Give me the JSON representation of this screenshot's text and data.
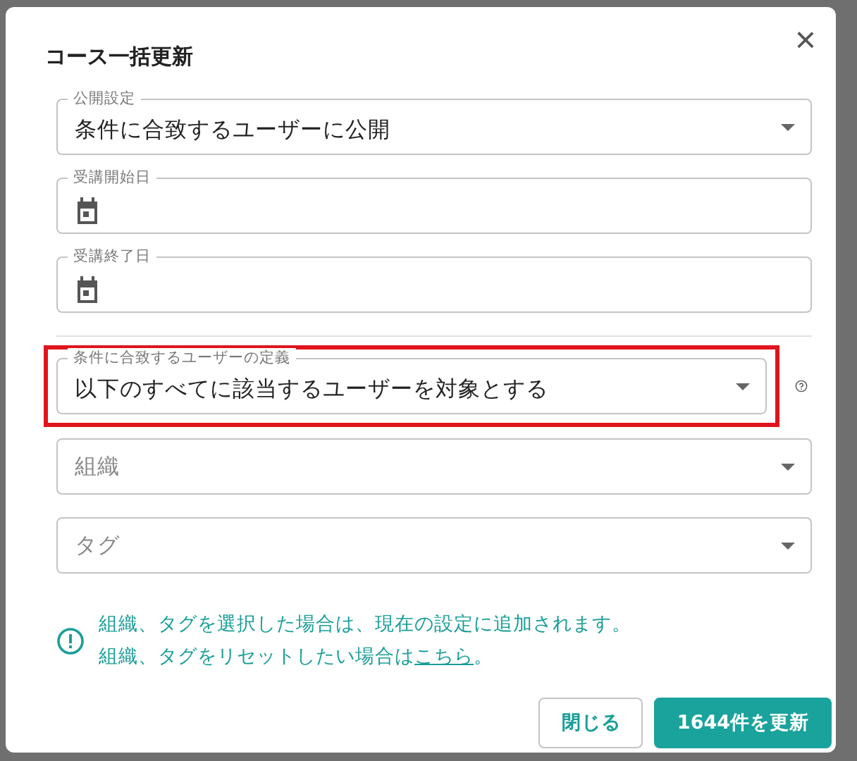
{
  "dialog": {
    "title": "コース一括更新",
    "close": "×"
  },
  "fields": [
    {
      "kind": "select",
      "label": "公開設定",
      "value": "条件に合致するユーザーに公開"
    },
    {
      "kind": "date",
      "label": "受講開始日"
    },
    {
      "kind": "date",
      "label": "受講終了日"
    },
    {
      "kind": "divider"
    },
    {
      "kind": "select",
      "label": "条件に合致するユーザーの定義",
      "value": "以下のすべてに該当するユーザーを対象とする",
      "highlighted": true,
      "help": true
    },
    {
      "kind": "select",
      "placeholder": "組織"
    },
    {
      "kind": "select",
      "placeholder": "タグ"
    }
  ],
  "notice": {
    "line_1": "組織、タグを選択した場合は、現在の設定に追加されます。",
    "line_2": "組織、タグをリセットしたい場合は",
    "link": "こちら",
    "line_2_end": "。"
  },
  "buttons": [
    {
      "label": "閉じる",
      "kind": "secondary"
    },
    {
      "label": "1644件を更新",
      "kind": "primary"
    }
  ]
}
